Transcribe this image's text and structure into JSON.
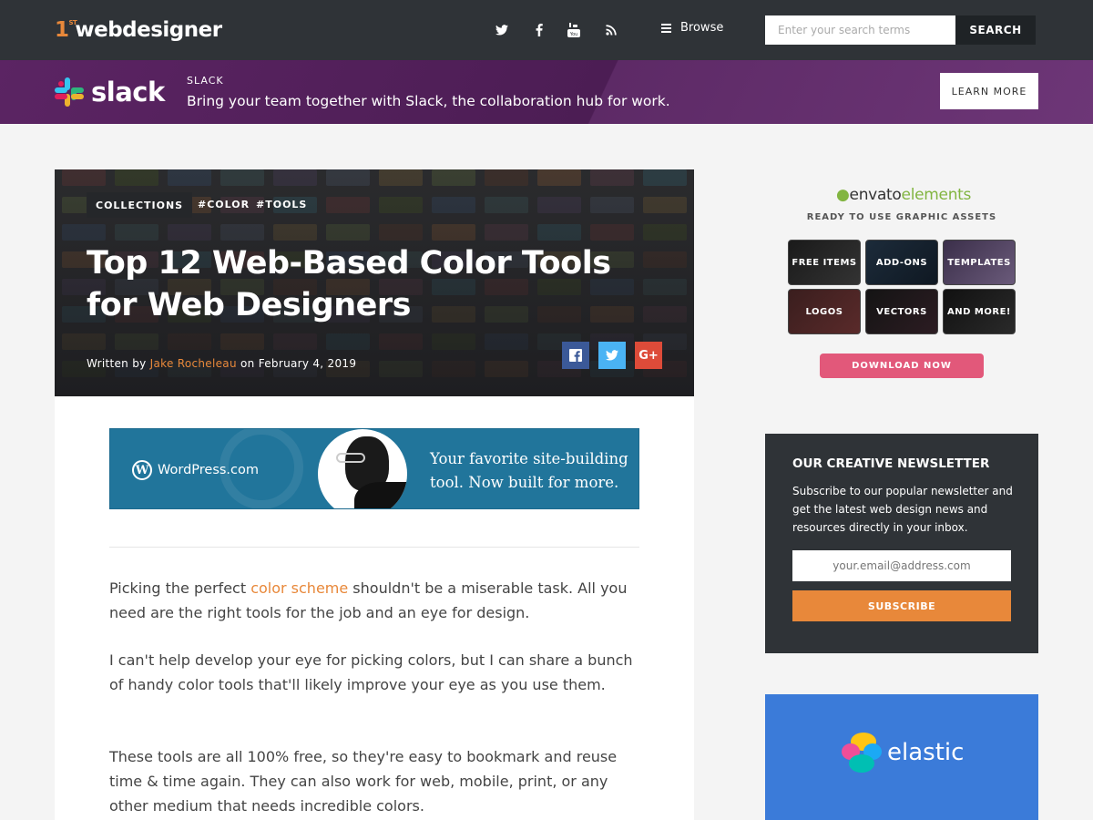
{
  "header": {
    "logo_prefix": "1",
    "logo_superscript": "ST",
    "logo_text": "webdesigner",
    "social_icons": [
      "twitter-icon",
      "facebook-icon",
      "youtube-icon",
      "rss-icon"
    ],
    "browse_label": "Browse",
    "search_placeholder": "Enter your search terms",
    "search_button": "SEARCH"
  },
  "slack_banner": {
    "logo_text": "slack",
    "kicker": "SLACK",
    "text": "Bring your team together with Slack, the collaboration hub for work.",
    "button": "LEARN MORE",
    "bg_color": "#4c1d54"
  },
  "hero": {
    "category": "COLLECTIONS",
    "tags": [
      "#COLOR",
      "#TOOLS"
    ],
    "title": "Top 12 Web-Based Color Tools for Web Designers",
    "written_by": "Written by",
    "author": "Jake Rocheleau",
    "date_prefix": "on",
    "date": "February 4, 2019",
    "share": {
      "facebook": "f",
      "twitter": "t",
      "googleplus": "G+"
    }
  },
  "wp_ad": {
    "brand": "WordPress.com",
    "tagline": "Your favorite site-building tool. Now built for more."
  },
  "article": {
    "p1_before": "Picking the perfect ",
    "p1_link": "color scheme",
    "p1_after": " shouldn't be a miserable task. All you need are the right tools for the job and an eye for design.",
    "p2": "I can't help develop your eye for picking colors, but I can share a bunch of handy color tools that'll likely improve your eye as you use them.",
    "p3": "These tools are all 100% free, so they're easy to bookmark and reuse time & time again. They can also work for web, mobile, print, or any other medium that needs incredible colors."
  },
  "envato": {
    "logo_main": "envato",
    "logo_sub": "elements",
    "subtitle": "READY TO USE GRAPHIC ASSETS",
    "tiles": [
      "FREE ITEMS",
      "ADD-ONS",
      "TEMPLATES",
      "LOGOS",
      "VECTORS",
      "AND MORE!"
    ],
    "button": "DOWNLOAD NOW"
  },
  "newsletter": {
    "title": "OUR CREATIVE NEWSLETTER",
    "text": "Subscribe to our popular newsletter and get the latest web design news and resources directly in your inbox.",
    "email_placeholder": "your.email@address.com",
    "button": "SUBSCRIBE"
  },
  "elastic": {
    "logo_text": "elastic"
  },
  "colors": {
    "accent_orange": "#e8883a",
    "nav_dark": "#2f3337",
    "elastic_blue": "#3b7bd9"
  }
}
